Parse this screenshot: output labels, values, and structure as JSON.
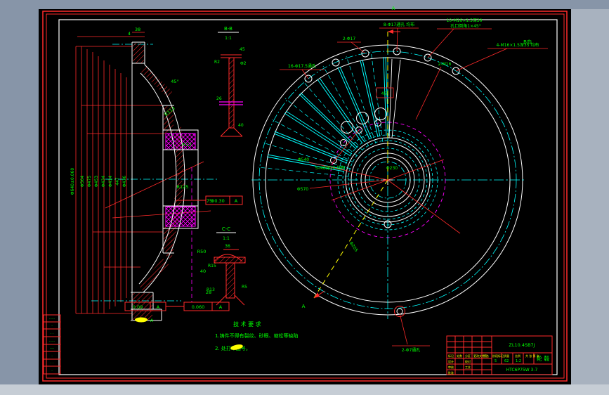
{
  "left_view": {
    "dim_top": "38",
    "dim_top2": "4",
    "vdims": [
      "Φ640±0.060",
      "Φ564",
      "Φ475",
      "Φ453",
      "Φ434",
      "Φ414",
      "447",
      "Φ436"
    ],
    "dims": [
      "R113",
      "R125",
      "75",
      "R50",
      "40",
      "28",
      "M12",
      "45°"
    ],
    "fcf": [
      {
        "val": "0.09",
        "datum": "A"
      },
      {
        "val": "0.060",
        "datum": "A"
      },
      {
        "val": "Φ0.30",
        "datum": "A"
      }
    ],
    "datum": "A"
  },
  "section_b": {
    "title": "B-B",
    "scale": "1:1",
    "dims": [
      "45",
      "R2",
      "Φ2",
      "26",
      "40"
    ]
  },
  "section_c": {
    "title": "C-C",
    "scale": "1:1",
    "dims": [
      "36",
      "R15",
      "R13",
      "R5"
    ]
  },
  "circle_view": {
    "labels": [
      "16-Φ17.5通孔",
      "2-Φ17",
      "8-Φ17通孔 均布",
      "10-M16×1.5深30",
      "孔口倒角1×45°",
      "4-M16×1.5深35 均布",
      "2-M16",
      "5-M8深20 均布",
      "Φ230",
      "Φ540",
      "Φ570",
      "2-Φ7通孔",
      "Φ205"
    ],
    "angle_label": "45°",
    "section_letter_top": "A",
    "section_letter_bottom": "A",
    "view_label": "B向"
  },
  "notes": {
    "title": "技 术 要 求",
    "item1": "1.铸件不得有裂纹、砂眼、缩松等缺陷",
    "item2": "2.          处打印图号。"
  },
  "title_block": {
    "drawing_no": "ZL10.4SB7J",
    "part_name": "轮 毂",
    "code": "HTC6P75W 3-7",
    "mass": "62",
    "scale_val": "1:2",
    "sheet": "5",
    "labels": [
      "标记",
      "处数",
      "分区",
      "更改文件号",
      "签名",
      "设计",
      "校对",
      "审核",
      "工艺",
      "批准",
      "阶段标记",
      "质量",
      "比例",
      "共 张  第 张"
    ]
  },
  "rev_strip": {
    "rows": [
      "·····",
      "·",
      "· ·",
      "·····",
      "····",
      "·",
      "· ·",
      "·"
    ]
  },
  "colors": {
    "red": "#ff2a2a",
    "green": "#00ff00",
    "cyan": "#00ffff",
    "magenta": "#ff00ff",
    "yellow": "#ffff00",
    "white": "#ffffff",
    "surround": "#8795a8"
  }
}
